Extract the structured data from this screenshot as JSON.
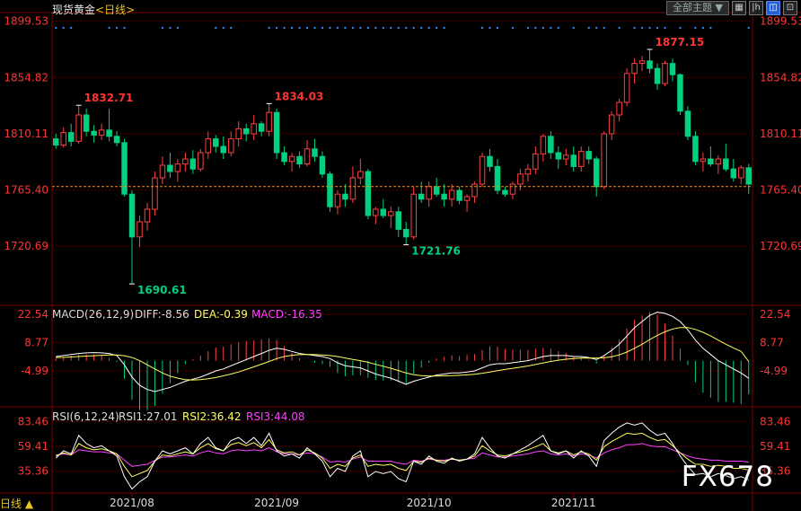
{
  "header": {
    "symbol": "现货黄金",
    "bracket_open": "<",
    "period": "日线",
    "bracket_close": ">"
  },
  "toolbar": {
    "theme_label": "全部主题",
    "dropdown": "▼",
    "b1": "▦",
    "b2": "|h",
    "b3": "◫",
    "b4": "⊡"
  },
  "bottom": {
    "period": "日线",
    "arrow": "▲"
  },
  "watermark": "FX678",
  "colors": {
    "up": "#ff4040",
    "down": "#00d080",
    "grid": "#7a0000",
    "axis_text_red": "#ff3333",
    "diff": "#ffffff",
    "dea": "#ffff60",
    "macd_label": "#ff40ff",
    "rsi1": "#ffffff",
    "rsi2": "#ffff60",
    "rsi3": "#ff40ff",
    "dots": "#2e8bff",
    "current": "#ff8c00"
  },
  "chart_data": [
    {
      "type": "candlestick",
      "name": "main",
      "y_ticks": [
        1899.53,
        1854.82,
        1810.11,
        1765.4,
        1720.69
      ],
      "ylim": [
        1675,
        1905
      ],
      "current_price": 1768,
      "x_ticks": [
        "2021/08",
        "2021/09",
        "2021/10",
        "2021/11"
      ],
      "x_tick_index": [
        10,
        29,
        49,
        68
      ],
      "annotations": [
        {
          "label": "1832.71",
          "idx": 3,
          "price": 1832.71,
          "kind": "high"
        },
        {
          "label": "1690.61",
          "idx": 10,
          "price": 1690.61,
          "kind": "low"
        },
        {
          "label": "1834.03",
          "idx": 28,
          "price": 1834.03,
          "kind": "high"
        },
        {
          "label": "1721.76",
          "idx": 46,
          "price": 1721.76,
          "kind": "low"
        },
        {
          "label": "1877.15",
          "idx": 78,
          "price": 1877.15,
          "kind": "high"
        }
      ],
      "ohlc": [
        [
          1806,
          1810,
          1798,
          1801
        ],
        [
          1801,
          1815,
          1799,
          1811
        ],
        [
          1811,
          1818,
          1800,
          1804
        ],
        [
          1804,
          1832.71,
          1802,
          1825
        ],
        [
          1825,
          1830,
          1808,
          1812
        ],
        [
          1812,
          1817,
          1803,
          1809
        ],
        [
          1809,
          1818,
          1805,
          1813
        ],
        [
          1813,
          1830,
          1804,
          1808
        ],
        [
          1808,
          1812,
          1800,
          1803
        ],
        [
          1803,
          1806,
          1760,
          1762
        ],
        [
          1762,
          1765,
          1690.61,
          1728
        ],
        [
          1728,
          1745,
          1720,
          1740
        ],
        [
          1740,
          1755,
          1733,
          1750
        ],
        [
          1750,
          1780,
          1745,
          1775
        ],
        [
          1775,
          1792,
          1770,
          1785
        ],
        [
          1785,
          1795,
          1775,
          1780
        ],
        [
          1780,
          1790,
          1772,
          1786
        ],
        [
          1786,
          1795,
          1780,
          1790
        ],
        [
          1790,
          1797,
          1778,
          1782
        ],
        [
          1782,
          1798,
          1780,
          1795
        ],
        [
          1795,
          1812,
          1790,
          1806
        ],
        [
          1806,
          1809,
          1795,
          1800
        ],
        [
          1800,
          1808,
          1790,
          1795
        ],
        [
          1795,
          1812,
          1792,
          1806
        ],
        [
          1806,
          1820,
          1800,
          1814
        ],
        [
          1814,
          1818,
          1804,
          1810
        ],
        [
          1810,
          1825,
          1805,
          1818
        ],
        [
          1818,
          1820,
          1808,
          1812
        ],
        [
          1812,
          1834.03,
          1808,
          1827
        ],
        [
          1827,
          1830,
          1790,
          1795
        ],
        [
          1795,
          1800,
          1785,
          1788
        ],
        [
          1788,
          1795,
          1780,
          1792
        ],
        [
          1792,
          1796,
          1783,
          1786
        ],
        [
          1786,
          1805,
          1784,
          1798
        ],
        [
          1798,
          1806,
          1788,
          1792
        ],
        [
          1792,
          1796,
          1775,
          1778
        ],
        [
          1778,
          1780,
          1748,
          1752
        ],
        [
          1752,
          1765,
          1746,
          1762
        ],
        [
          1762,
          1770,
          1752,
          1758
        ],
        [
          1758,
          1784,
          1755,
          1775
        ],
        [
          1775,
          1790,
          1770,
          1780
        ],
        [
          1780,
          1782,
          1742,
          1745
        ],
        [
          1745,
          1752,
          1738,
          1750
        ],
        [
          1750,
          1758,
          1743,
          1745
        ],
        [
          1745,
          1752,
          1735,
          1748
        ],
        [
          1748,
          1752,
          1728,
          1734
        ],
        [
          1734,
          1740,
          1721.76,
          1728
        ],
        [
          1728,
          1768,
          1726,
          1762
        ],
        [
          1762,
          1772,
          1755,
          1758
        ],
        [
          1758,
          1772,
          1752,
          1768
        ],
        [
          1768,
          1775,
          1760,
          1762
        ],
        [
          1762,
          1770,
          1752,
          1758
        ],
        [
          1758,
          1770,
          1752,
          1765
        ],
        [
          1765,
          1768,
          1754,
          1757
        ],
        [
          1757,
          1762,
          1748,
          1760
        ],
        [
          1760,
          1772,
          1755,
          1770
        ],
        [
          1770,
          1795,
          1768,
          1792
        ],
        [
          1792,
          1798,
          1780,
          1784
        ],
        [
          1784,
          1790,
          1762,
          1765
        ],
        [
          1765,
          1768,
          1760,
          1762
        ],
        [
          1762,
          1772,
          1758,
          1770
        ],
        [
          1770,
          1782,
          1765,
          1778
        ],
        [
          1778,
          1786,
          1772,
          1782
        ],
        [
          1782,
          1800,
          1778,
          1794
        ],
        [
          1794,
          1810,
          1788,
          1808
        ],
        [
          1808,
          1812,
          1790,
          1795
        ],
        [
          1795,
          1800,
          1782,
          1790
        ],
        [
          1790,
          1798,
          1785,
          1793
        ],
        [
          1793,
          1800,
          1780,
          1784
        ],
        [
          1784,
          1800,
          1780,
          1796
        ],
        [
          1796,
          1800,
          1786,
          1790
        ],
        [
          1790,
          1792,
          1760,
          1768
        ],
        [
          1768,
          1812,
          1766,
          1810
        ],
        [
          1810,
          1828,
          1805,
          1825
        ],
        [
          1825,
          1838,
          1820,
          1835
        ],
        [
          1835,
          1862,
          1832,
          1858
        ],
        [
          1858,
          1870,
          1850,
          1866
        ],
        [
          1866,
          1872,
          1860,
          1868
        ],
        [
          1868,
          1877.15,
          1858,
          1862
        ],
        [
          1862,
          1866,
          1845,
          1850
        ],
        [
          1850,
          1868,
          1848,
          1866
        ],
        [
          1866,
          1870,
          1852,
          1857
        ],
        [
          1857,
          1858,
          1825,
          1828
        ],
        [
          1828,
          1832,
          1805,
          1808
        ],
        [
          1808,
          1812,
          1785,
          1788
        ],
        [
          1788,
          1795,
          1780,
          1790
        ],
        [
          1790,
          1800,
          1784,
          1786
        ],
        [
          1786,
          1793,
          1778,
          1790
        ],
        [
          1790,
          1802,
          1780,
          1782
        ],
        [
          1782,
          1790,
          1772,
          1775
        ],
        [
          1775,
          1785,
          1770,
          1783
        ],
        [
          1783,
          1786,
          1762,
          1770
        ]
      ]
    },
    {
      "type": "line+bar",
      "name": "MACD",
      "title": "MACD(26,12,9)",
      "legend": [
        {
          "label": "DIFF:-8.56",
          "color": "#ffffff"
        },
        {
          "label": "DEA:-0.39",
          "color": "#ffff60"
        },
        {
          "label": "MACD:-16.35",
          "color": "#ff40ff"
        }
      ],
      "y_ticks": [
        22.54,
        8.77,
        -4.99
      ],
      "ylim": [
        -22,
        26
      ],
      "diff": [
        2.0,
        2.5,
        3.0,
        3.5,
        3.8,
        3.9,
        3.8,
        3.5,
        2.5,
        -2,
        -8,
        -12,
        -14,
        -15,
        -14,
        -13,
        -11.5,
        -10,
        -9,
        -8,
        -6.5,
        -5,
        -4,
        -2.5,
        -1,
        0.5,
        2,
        3.5,
        5,
        6,
        5.5,
        4.5,
        3.5,
        3,
        2.5,
        2,
        1,
        -1,
        -2.5,
        -3,
        -3.5,
        -5,
        -6.5,
        -7.5,
        -8.5,
        -10,
        -11.5,
        -10,
        -9,
        -8,
        -7,
        -6.5,
        -6,
        -6,
        -5.5,
        -5,
        -3.5,
        -2,
        -1.5,
        -1.5,
        -1,
        -0.5,
        0,
        1,
        2,
        2.5,
        2.5,
        2.5,
        2,
        2,
        1.5,
        0.5,
        2.5,
        5,
        8,
        12,
        16,
        19,
        22,
        23.5,
        23,
        21.5,
        19,
        15,
        10,
        6,
        3,
        0,
        -2,
        -4,
        -6,
        -8.56
      ],
      "dea": [
        1.5,
        1.6,
        1.8,
        2.0,
        2.2,
        2.4,
        2.6,
        2.8,
        2.8,
        2.4,
        1.5,
        0,
        -2,
        -4,
        -6,
        -7.5,
        -8.5,
        -9.2,
        -9.4,
        -9.2,
        -8.8,
        -8.2,
        -7.4,
        -6.5,
        -5.5,
        -4.3,
        -3,
        -1.7,
        -0.4,
        1,
        2,
        2.6,
        2.9,
        3.0,
        3,
        2.8,
        2.5,
        2,
        1.3,
        0.6,
        0,
        -0.8,
        -1.8,
        -2.7,
        -3.7,
        -4.8,
        -6,
        -6.8,
        -7.3,
        -7.5,
        -7.5,
        -7.4,
        -7.3,
        -7.1,
        -6.9,
        -6.6,
        -6.1,
        -5.5,
        -4.9,
        -4.3,
        -3.7,
        -3.2,
        -2.6,
        -1.9,
        -1.1,
        -0.4,
        0.2,
        0.7,
        1,
        1.2,
        1.3,
        1.2,
        1.4,
        1.9,
        2.8,
        4.2,
        6,
        8,
        10.2,
        12.3,
        14,
        15.4,
        16.1,
        16.1,
        15.2,
        13.8,
        12,
        10,
        8,
        6.2,
        4.5,
        -0.39
      ]
    },
    {
      "type": "line",
      "name": "RSI",
      "title": "RSI(6,12,24)",
      "legend": [
        {
          "label": "RSI1:27.01",
          "color": "#ffffff"
        },
        {
          "label": "RSI2:36.42",
          "color": "#ffff60"
        },
        {
          "label": "RSI3:44.08",
          "color": "#ff40ff"
        }
      ],
      "y_ticks": [
        83.46,
        59.41,
        35.36
      ],
      "ylim": [
        15,
        95
      ],
      "rsi1": [
        48,
        55,
        52,
        70,
        62,
        58,
        60,
        55,
        50,
        30,
        18,
        25,
        30,
        45,
        55,
        52,
        55,
        58,
        52,
        62,
        68,
        58,
        55,
        65,
        68,
        62,
        68,
        60,
        72,
        55,
        50,
        52,
        48,
        58,
        52,
        45,
        30,
        38,
        35,
        50,
        55,
        30,
        35,
        33,
        35,
        28,
        25,
        45,
        42,
        50,
        45,
        43,
        48,
        45,
        47,
        52,
        68,
        58,
        50,
        48,
        52,
        56,
        60,
        65,
        70,
        55,
        52,
        55,
        48,
        55,
        50,
        40,
        65,
        72,
        78,
        82,
        80,
        82,
        75,
        70,
        72,
        62,
        50,
        40,
        32,
        33,
        30,
        33,
        31,
        28,
        30,
        27.01
      ],
      "rsi2": [
        50,
        53,
        51,
        62,
        58,
        56,
        57,
        55,
        52,
        40,
        30,
        33,
        36,
        45,
        51,
        50,
        52,
        54,
        52,
        58,
        62,
        57,
        55,
        61,
        63,
        60,
        63,
        58,
        66,
        56,
        53,
        54,
        51,
        56,
        53,
        48,
        38,
        42,
        40,
        48,
        51,
        40,
        42,
        41,
        42,
        38,
        36,
        45,
        44,
        48,
        46,
        45,
        47,
        46,
        47,
        50,
        60,
        55,
        51,
        50,
        52,
        54,
        56,
        59,
        62,
        55,
        53,
        55,
        51,
        54,
        52,
        46,
        59,
        64,
        68,
        72,
        71,
        72,
        68,
        65,
        66,
        60,
        53,
        47,
        42,
        42,
        40,
        41,
        40,
        38,
        38,
        36.42
      ],
      "rsi3": [
        51,
        52,
        51,
        56,
        55,
        54,
        54,
        53,
        52,
        46,
        40,
        41,
        42,
        46,
        49,
        49,
        50,
        51,
        50,
        53,
        55,
        53,
        52,
        55,
        56,
        55,
        56,
        55,
        58,
        54,
        52,
        52,
        51,
        53,
        52,
        49,
        44,
        45,
        44,
        47,
        49,
        45,
        45,
        45,
        45,
        43,
        42,
        46,
        45,
        47,
        46,
        46,
        47,
        46,
        47,
        48,
        53,
        51,
        49,
        49,
        50,
        51,
        52,
        54,
        55,
        52,
        51,
        52,
        50,
        52,
        51,
        48,
        53,
        56,
        58,
        61,
        61,
        62,
        60,
        59,
        59,
        56,
        53,
        50,
        48,
        47,
        46,
        46,
        45,
        45,
        45,
        44.08
      ]
    }
  ]
}
